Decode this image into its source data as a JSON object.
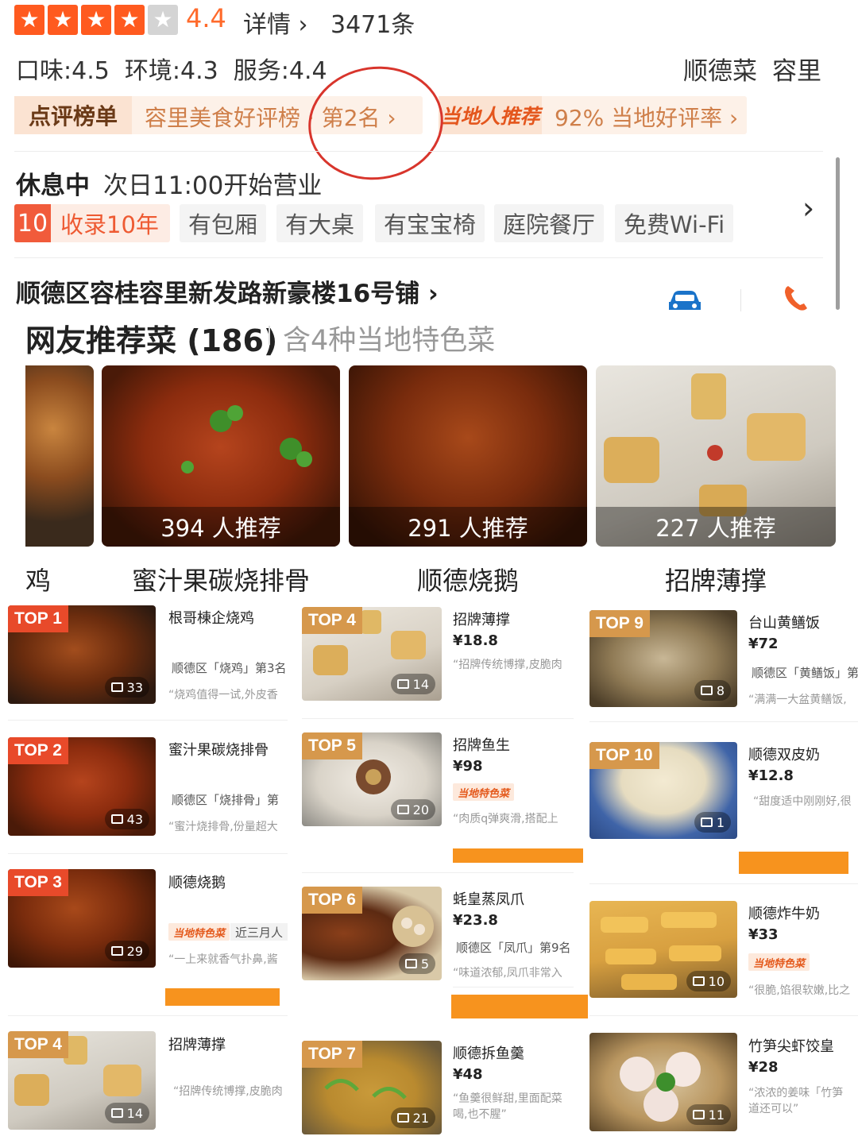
{
  "rating": {
    "stars_filled": 4,
    "stars_total": 5,
    "value": "4.4",
    "details_link": "详情 ›",
    "review_count": "3471条"
  },
  "scores": {
    "text": "口味:4.5  环境:4.3  服务:4.4"
  },
  "header": {
    "cuisine": "顺德菜",
    "area": "容里"
  },
  "ranking": {
    "head": "点评榜单",
    "text": "容里美食好评榜 · 第2名 ›"
  },
  "local": {
    "head": "当地人推荐",
    "text": "92% 当地好评率 ›"
  },
  "status": {
    "state": "休息中",
    "note": "次日11:00开始营业"
  },
  "tags": {
    "years_num": "10",
    "years_text": "收录10年",
    "items": [
      "有包厢",
      "有大桌",
      "有宝宝椅",
      "庭院餐厅",
      "免费Wi-Fi"
    ]
  },
  "address": {
    "text": "顺德区容桂容里新发路新豪楼16号铺 ›"
  },
  "recommend": {
    "title": "网友推荐菜 (186)",
    "subtitle": "含4种当地特色菜"
  },
  "featured": [
    {
      "name": "鸡",
      "recommend": ""
    },
    {
      "name": "蜜汁果碳烧排骨",
      "recommend": "394 人推荐"
    },
    {
      "name": "顺德烧鹅",
      "recommend": "291 人推荐"
    },
    {
      "name": "招牌薄撑",
      "recommend": "227 人推荐"
    }
  ],
  "dishes": {
    "col1": [
      {
        "badge": "TOP 1",
        "name": "根哥棟企烧鸡",
        "price": "",
        "rank": "顺德区「烧鸡」第3名",
        "quote": "“烧鸡值得一试,外皮香",
        "photos": "33"
      },
      {
        "badge": "TOP 2",
        "name": "蜜汁果碳烧排骨",
        "price": "",
        "rank": "顺德区「烧排骨」第",
        "quote": "“蜜汁烧排骨,份量超大",
        "photos": "43"
      },
      {
        "badge": "TOP 3",
        "name": "顺德烧鹅",
        "price": "",
        "rank": "",
        "local": "当地特色菜",
        "extra": "近三月人",
        "quote": "“一上来就香气扑鼻,酱",
        "photos": "29"
      },
      {
        "badge": "TOP 4",
        "name": "招牌薄撑",
        "price": "",
        "rank": "",
        "quote": "“招牌传统博撑,皮脆肉",
        "photos": "14"
      }
    ],
    "col2": [
      {
        "badge": "TOP 4",
        "name": "招牌薄撑",
        "price": "¥18.8",
        "rank": "",
        "quote": "“招牌传统博撑,皮脆肉",
        "photos": "14"
      },
      {
        "badge": "TOP 5",
        "name": "招牌鱼生",
        "price": "¥98",
        "local": "当地特色菜",
        "rank": "",
        "quote": "“肉质q弹爽滑,搭配上",
        "photos": "20"
      },
      {
        "badge": "TOP 6",
        "name": "蚝皇蒸凤爪",
        "price": "¥23.8",
        "rank": "顺德区「凤爪」第9名",
        "quote": "“味道浓郁,凤爪非常入",
        "photos": "5"
      },
      {
        "badge": "TOP 7",
        "name": "顺德拆鱼羹",
        "price": "¥48",
        "rank": "",
        "quote": "“鱼羹很鲜甜,里面配菜",
        "quote2": "喝,也不腥”",
        "photos": "21"
      }
    ],
    "col3": [
      {
        "badge": "TOP 9",
        "name": "台山黄鳝饭",
        "price": "¥72",
        "rank": "顺德区「黄鳝饭」第",
        "quote": "“满满一大盆黄鳝饭,",
        "photos": "8"
      },
      {
        "badge": "TOP 10",
        "name": "顺德双皮奶",
        "price": "¥12.8",
        "rank": "",
        "quote": "“甜度适中刚刚好,很",
        "photos": "1"
      },
      {
        "badge": "",
        "name": "顺德炸牛奶",
        "price": "¥33",
        "local": "当地特色菜",
        "rank": "",
        "quote": "“很脆,馅很软嫩,比之",
        "photos": "10"
      },
      {
        "badge": "",
        "name": "竹笋尖虾饺皇",
        "price": "¥28",
        "rank": "",
        "quote": "“浓浓的姜味「竹笋",
        "quote2": "道还可以”",
        "photos": "11"
      }
    ]
  },
  "colors": {
    "accent": "#ff5a1f",
    "local_tag": "#e45a1d",
    "circle": "#d8352c",
    "redaction": "#f7931e"
  }
}
